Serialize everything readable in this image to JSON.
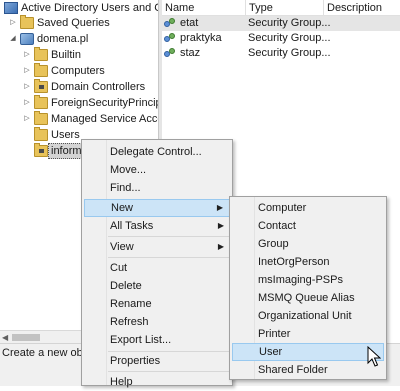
{
  "tree": {
    "items": [
      {
        "label": "Active Directory Users and Com"
      },
      {
        "label": "Saved Queries"
      },
      {
        "label": "domena.pl"
      },
      {
        "label": "Builtin"
      },
      {
        "label": "Computers"
      },
      {
        "label": "Domain Controllers"
      },
      {
        "label": "ForeignSecurityPrincipals"
      },
      {
        "label": "Managed Service Accour"
      },
      {
        "label": "Users"
      },
      {
        "label": "informatycy"
      }
    ]
  },
  "list": {
    "columns": [
      "Name",
      "Type",
      "Description"
    ],
    "rows": [
      {
        "name": "etat",
        "type": "Security Group..."
      },
      {
        "name": "praktyka",
        "type": "Security Group..."
      },
      {
        "name": "staz",
        "type": "Security Group..."
      }
    ]
  },
  "status": {
    "text": "Create a new object"
  },
  "context_menu": {
    "items": [
      "Delegate Control...",
      "Move...",
      "Find...",
      "New",
      "All Tasks",
      "View",
      "Cut",
      "Delete",
      "Rename",
      "Refresh",
      "Export List...",
      "Properties",
      "Help"
    ]
  },
  "new_submenu": {
    "items": [
      "Computer",
      "Contact",
      "Group",
      "InetOrgPerson",
      "msImaging-PSPs",
      "MSMQ Queue Alias",
      "Organizational Unit",
      "Printer",
      "User",
      "Shared Folder"
    ]
  },
  "colors": {
    "highlight": "#cce4f7",
    "highlight_border": "#99c9ef",
    "menu_bg": "#f0f0f0",
    "folder": "#e8c35a"
  }
}
